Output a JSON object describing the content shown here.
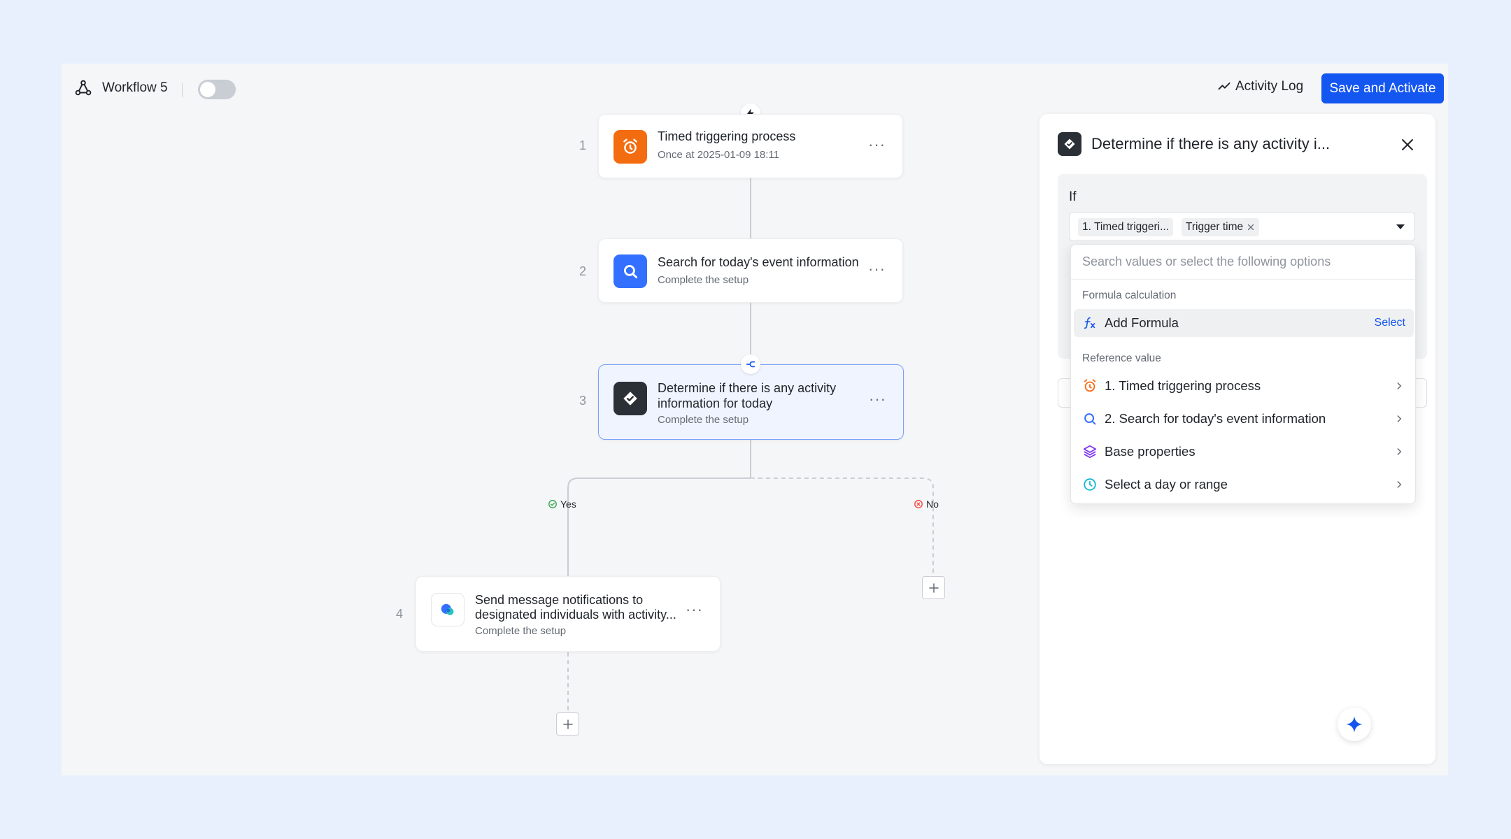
{
  "header": {
    "workflow_name": "Workflow 5",
    "activity_log": "Activity Log",
    "save_activate": "Save and Activate"
  },
  "nodes": [
    {
      "num": "1",
      "title": "Timed triggering process",
      "subtitle": "Once at 2025-01-09 18:11",
      "icon": "alarm-clock-icon",
      "color": "#f36c10"
    },
    {
      "num": "2",
      "title": "Search for today's event information",
      "subtitle": "Complete the setup",
      "icon": "search-icon",
      "color": "#3370ff"
    },
    {
      "num": "3",
      "title_line1": "Determine if there is any activity",
      "title_line2": "information for today",
      "subtitle": "Complete the setup",
      "icon": "check-diamond-icon",
      "color": "#2b2f36"
    },
    {
      "num": "4",
      "title_line1": "Send message notifications to",
      "title_line2": "designated individuals with activity...",
      "subtitle": "Complete the setup",
      "icon": "chat-bubble-icon"
    }
  ],
  "branches": {
    "yes": "Yes",
    "no": "No"
  },
  "more_glyph": "···",
  "panel": {
    "title": "Determine if there is any activity i...",
    "if_label": "If",
    "chip1": "1. Timed triggeri...",
    "chip2": "Trigger time",
    "search_placeholder": "Search values or select the following options",
    "section_formula": "Formula calculation",
    "add_formula": "Add Formula",
    "select_label": "Select",
    "section_reference": "Reference value",
    "references": [
      {
        "label": "1. Timed triggering process",
        "icon": "alarm-clock-icon"
      },
      {
        "label": "2. Search for today's event information",
        "icon": "search-icon"
      },
      {
        "label": "Base properties",
        "icon": "layers-icon"
      },
      {
        "label": "Select a day or range",
        "icon": "clock-icon"
      }
    ]
  },
  "colors": {
    "primary": "#1456f0",
    "active_border": "#7aa2f7",
    "yes": "#34a853",
    "no": "#f54a45"
  }
}
